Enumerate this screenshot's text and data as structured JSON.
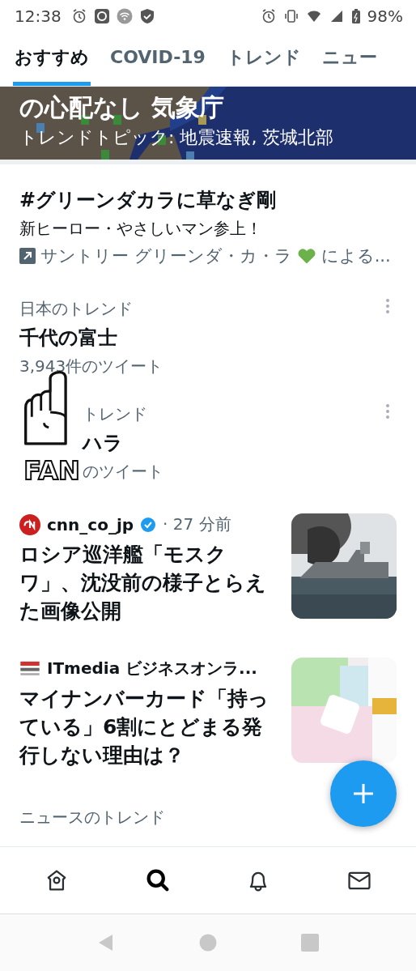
{
  "status_bar": {
    "time": "12:38",
    "battery": "98%"
  },
  "tabs": [
    {
      "label": "おすすめ",
      "selected": true
    },
    {
      "label": "COVID-19",
      "selected": false
    },
    {
      "label": "トレンド",
      "selected": false
    },
    {
      "label": "ニュー",
      "selected": false
    }
  ],
  "banner": {
    "headline": "の心配なし 気象庁",
    "subtitle": "トレンドトピック: 地震速報, 茨城北部"
  },
  "promoted": {
    "title": "#グリーンダカラに草なぎ剛",
    "description": "新ヒーロー・やさしいマン参上！",
    "sponsor": "サントリー グリーンダ・カ・ラ",
    "sponsor_tail": "による..."
  },
  "trends": [
    {
      "category": "日本のトレンド",
      "title": "千代の富士",
      "count": "3,943件のツイート"
    },
    {
      "category": "トレンド",
      "title": "ハラ",
      "count": "のツイート"
    }
  ],
  "sticker": {
    "text": "FAN"
  },
  "news": [
    {
      "kind": "circle",
      "source": "cnn_co_jp",
      "verified": true,
      "time": "· 27 分前",
      "headline": "ロシア巡洋艦「モスクワ」、沈没前の様子とらえた画像公開"
    },
    {
      "kind": "square",
      "source": "ITmedia ビジネスオンラ...",
      "verified": false,
      "headline": "マイナンバーカード「持っている」6割にとどまる発行しない理由は？"
    }
  ],
  "section_heading": "ニュースのトレンド",
  "bottom_nav": [
    {
      "kind": "home",
      "selected": false
    },
    {
      "kind": "search",
      "selected": true
    },
    {
      "kind": "bell",
      "selected": false
    },
    {
      "kind": "mail",
      "selected": false
    }
  ]
}
